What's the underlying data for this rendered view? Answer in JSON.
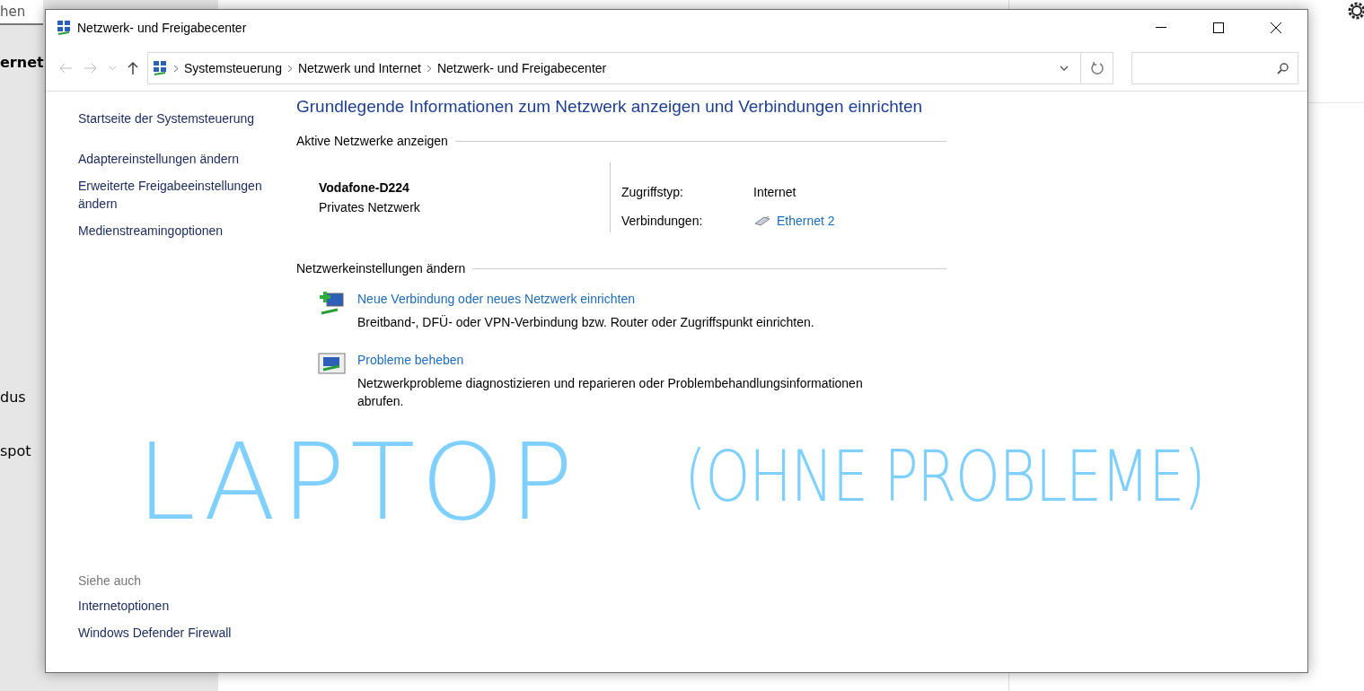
{
  "background": {
    "search_text": "hen",
    "items": [
      "ernet",
      "dus",
      "spot"
    ]
  },
  "window": {
    "title": "Netzwerk- und Freigabecenter"
  },
  "address_bar": {
    "crumbs": [
      "Systemsteuerung",
      "Netzwerk und Internet",
      "Netzwerk- und Freigabecenter"
    ]
  },
  "sidebar": {
    "items": [
      "Startseite der Systemsteuerung",
      "Adaptereinstellungen ändern",
      "Erweiterte Freigabeeinstellungen ändern",
      "Medienstreamingoptionen"
    ],
    "see_also_heading": "Siehe auch",
    "see_also": [
      "Internetoptionen",
      "Windows Defender Firewall"
    ]
  },
  "main": {
    "heading": "Grundlegende Informationen zum Netzwerk anzeigen und Verbindungen einrichten",
    "active_section": "Aktive Netzwerke anzeigen",
    "network": {
      "name": "Vodafone-D224",
      "category": "Privates Netzwerk",
      "access_label": "Zugriffstyp:",
      "access_value": "Internet",
      "connections_label": "Verbindungen:",
      "connection": "Ethernet 2"
    },
    "settings_section": "Netzwerkeinstellungen ändern",
    "tasks": [
      {
        "kind": "new",
        "title": "Neue Verbindung oder neues Netzwerk einrichten",
        "description": "Breitband-, DFÜ- oder VPN-Verbindung bzw. Router oder Zugriffspunkt einrichten."
      },
      {
        "kind": "troubleshoot",
        "title": "Probleme beheben",
        "description": "Netzwerkprobleme diagnostizieren und reparieren oder Problembehandlungsinformationen abrufen."
      }
    ]
  },
  "annotation": [
    "LAPTOP",
    "(OHNE PROBLEME)"
  ]
}
